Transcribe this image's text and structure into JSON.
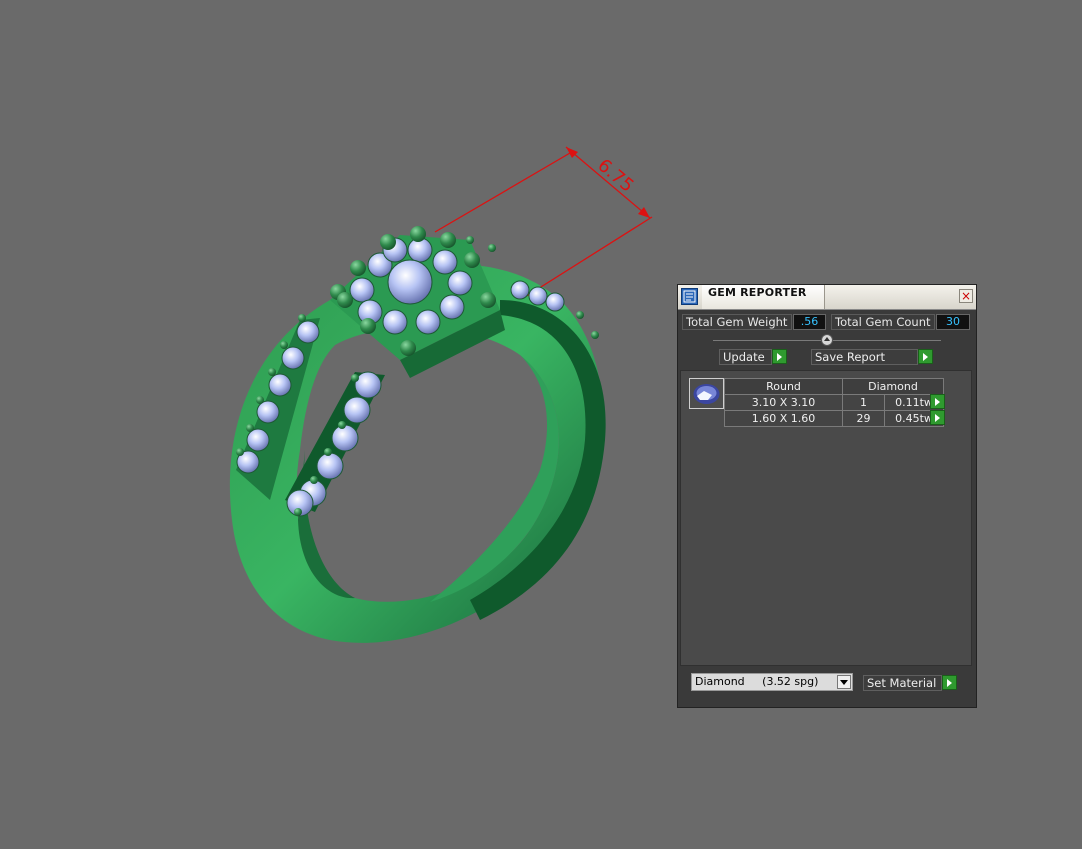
{
  "viewport": {
    "dimension_label": "6.75",
    "ring_color": "#34a85a",
    "gem_color": "#a9b8f0",
    "dimension_color": "#dd1111"
  },
  "panel": {
    "title": "GEM REPORTER",
    "close_glyph": "×",
    "total_weight_label": "Total Gem Weight",
    "total_weight_value": ".56",
    "total_count_label": "Total Gem Count",
    "total_count_value": "30",
    "update_label": "Update",
    "save_report_label": "Save Report",
    "table": {
      "shape_header": "Round",
      "material_header": "Diamond",
      "rows": [
        {
          "size": "3.10 X 3.10",
          "count": "1",
          "weight": "0.11tw"
        },
        {
          "size": "1.60 X 1.60",
          "count": "29",
          "weight": "0.45tw"
        }
      ]
    },
    "material_select_value": "Diamond     (3.52 spg)",
    "set_material_label": "Set Material"
  },
  "colors": {
    "value_text": "#37c3ff",
    "go_button": "#2f9a2f",
    "background": "#6a6a6a"
  }
}
